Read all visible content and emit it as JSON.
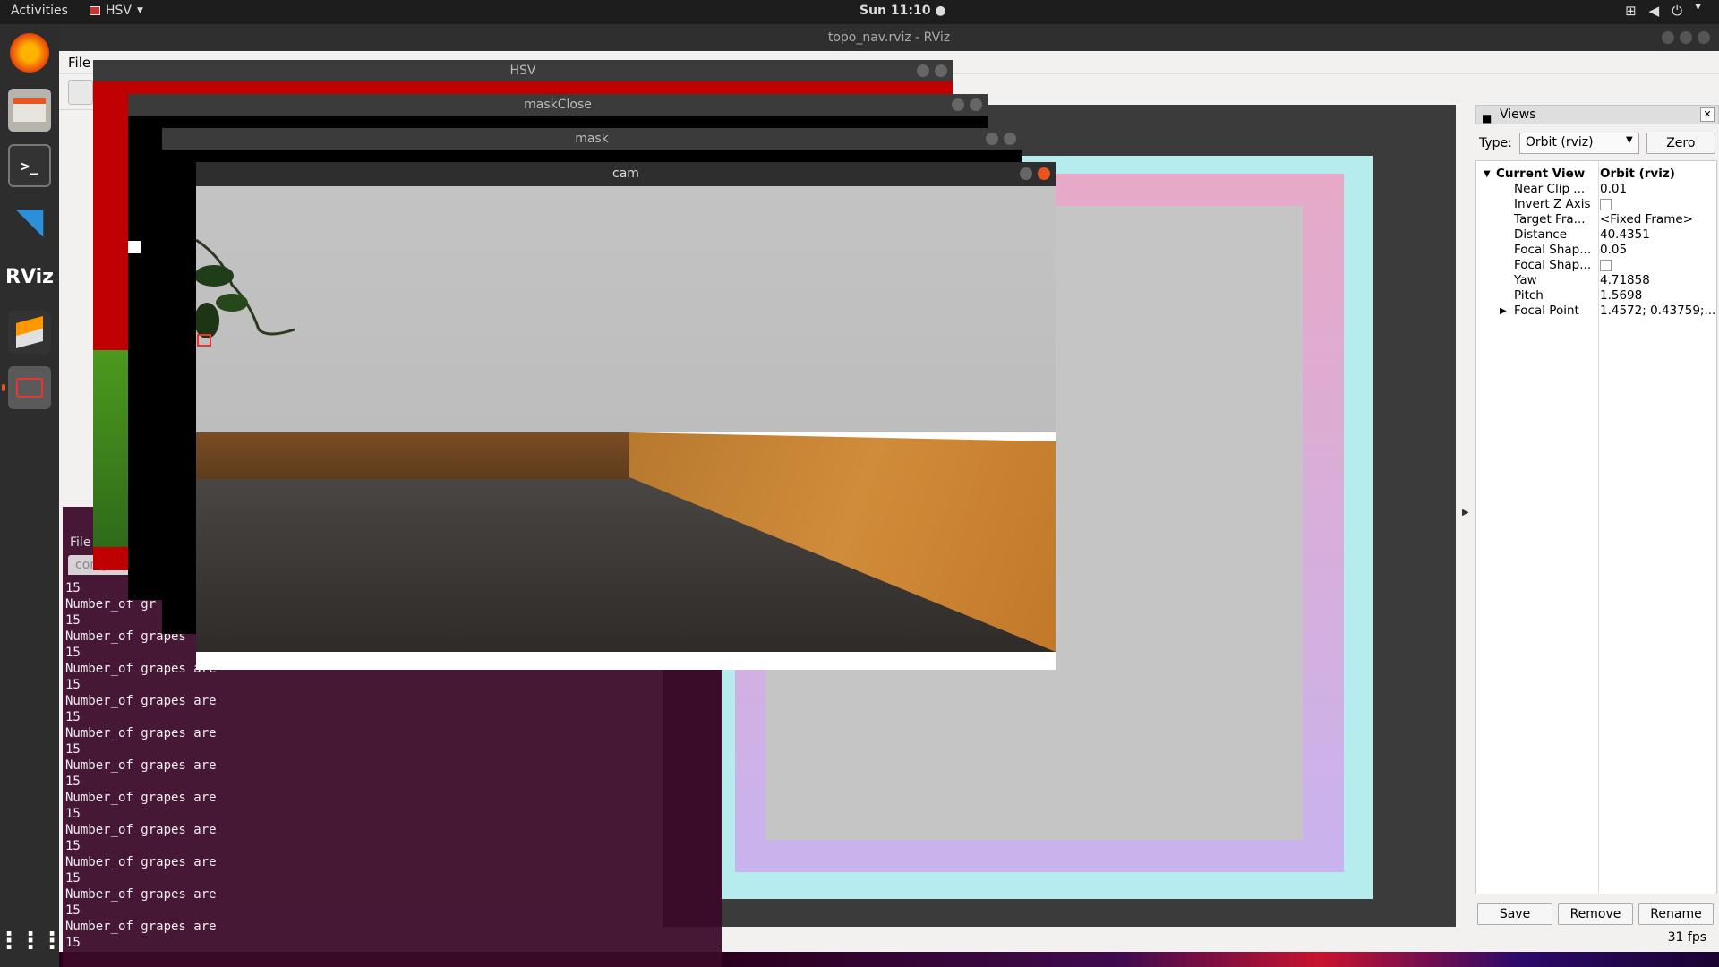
{
  "topbar": {
    "activities": "Activities",
    "app_name": "HSV",
    "clock": "Sun 11:10"
  },
  "dock": {
    "items": [
      "firefox-icon",
      "files-icon",
      "terminal-icon",
      "vscode-icon",
      "rviz-icon",
      "sublime-icon",
      "recorder-icon",
      "apps-grid-icon"
    ],
    "rviz_label": "RViz"
  },
  "rviz": {
    "title": "topo_nav.rviz - RViz",
    "menu_file": "File"
  },
  "windows": {
    "hsv": "HSV",
    "maskclose": "maskClose",
    "mask": "mask",
    "cam": "cam"
  },
  "views": {
    "panel_title": "Views",
    "type_label": "Type:",
    "type_value": "Orbit (rviz)",
    "zero_button": "Zero",
    "properties": [
      {
        "name": "Current View",
        "value": "Orbit (rviz)",
        "bold": true,
        "expander": "open"
      },
      {
        "name": "Near Clip ...",
        "value": "0.01"
      },
      {
        "name": "Invert Z Axis",
        "value": "",
        "checkbox": true
      },
      {
        "name": "Target Fra...",
        "value": "<Fixed Frame>"
      },
      {
        "name": "Distance",
        "value": "40.4351"
      },
      {
        "name": "Focal Shap...",
        "value": "0.05"
      },
      {
        "name": "Focal Shap...",
        "value": "",
        "checkbox": true
      },
      {
        "name": "Yaw",
        "value": "4.71858"
      },
      {
        "name": "Pitch",
        "value": "1.5698"
      },
      {
        "name": "Focal Point",
        "value": "1.4572; 0.43759;...",
        "expander": "closed"
      }
    ],
    "save_button": "Save",
    "remove_button": "Remove",
    "rename_button": "Rename",
    "fps": "31 fps"
  },
  "terminal": {
    "menu_file": "File",
    "tab_label": "comput",
    "lines": [
      "15",
      "Number_of gr",
      "15",
      "Number_of grapes",
      "15",
      "Number_of grapes are",
      "15",
      "Number_of grapes are",
      "15",
      "Number_of grapes are",
      "15",
      "Number_of grapes are",
      "15",
      "Number_of grapes are",
      "15",
      "Number_of grapes are",
      "15",
      "Number_of grapes are",
      "15",
      "Number_of grapes are",
      "15",
      "Number_of grapes are",
      "15"
    ]
  }
}
